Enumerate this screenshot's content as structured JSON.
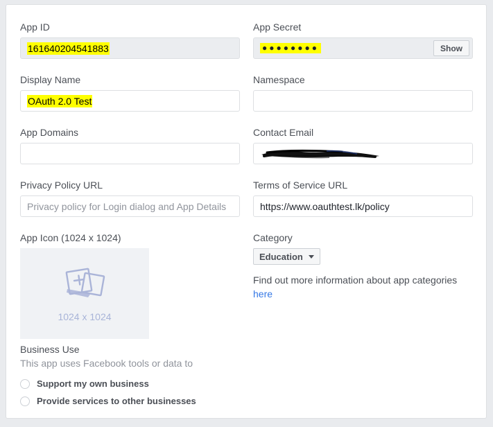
{
  "fields": {
    "app_id": {
      "label": "App ID",
      "value": "161640204541883",
      "readonly": true,
      "highlighted": true
    },
    "app_secret": {
      "label": "App Secret",
      "value": "●●●●●●●●",
      "show_button_label": "Show",
      "readonly": true,
      "highlighted": true
    },
    "display_name": {
      "label": "Display Name",
      "value": "OAuth 2.0 Test",
      "highlighted": true
    },
    "namespace": {
      "label": "Namespace",
      "value": ""
    },
    "app_domains": {
      "label": "App Domains",
      "value": ""
    },
    "contact_email": {
      "label": "Contact Email",
      "value": "",
      "redacted": true
    },
    "privacy_policy_url": {
      "label": "Privacy Policy URL",
      "value": "",
      "placeholder": "Privacy policy for Login dialog and App Details"
    },
    "terms_of_service_url": {
      "label": "Terms of Service URL",
      "value": "https://www.oauthtest.lk/policy"
    },
    "app_icon": {
      "label": "App Icon (1024 x 1024)",
      "placeholder_label": "1024 x 1024",
      "icon_name": "add-photos-icon"
    },
    "category": {
      "label": "Category",
      "selected": "Education",
      "help_text": "Find out more information about app categories",
      "help_link": "here"
    }
  },
  "business_use": {
    "title": "Business Use",
    "subtitle": "This app uses Facebook tools or data to",
    "options": [
      {
        "label": "Support my own business",
        "selected": false
      },
      {
        "label": "Provide services to other businesses",
        "selected": false
      }
    ]
  },
  "colors": {
    "highlight": "#ffff00",
    "link": "#3578e5",
    "label": "#4b4f56",
    "placeholder": "#90949c",
    "field_border": "#dddfe2",
    "readonly_bg": "#ebedf0",
    "icon_tint": "#a8b4d8",
    "page_bg": "#e9ebee"
  }
}
